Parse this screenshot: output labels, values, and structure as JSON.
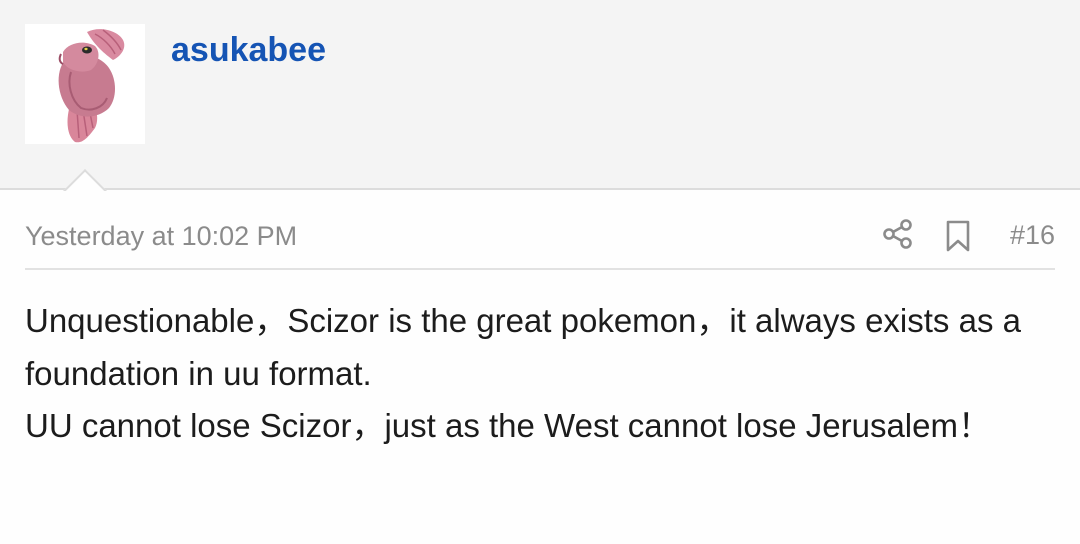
{
  "post": {
    "author": "asukabee",
    "timestamp": "Yesterday at 10:02 PM",
    "post_number": "#16",
    "body_paragraphs": [
      "Unquestionable，Scizor is the great pokemon，it always exists as a foundation in uu format.",
      "UU cannot lose Scizor，just as the West cannot lose Jerusalem！"
    ]
  },
  "icons": {
    "share": "share-icon",
    "bookmark": "bookmark-icon"
  },
  "colors": {
    "username": "#1554b4",
    "meta_text": "#8b8b8b",
    "header_bg": "#f4f4f4"
  }
}
